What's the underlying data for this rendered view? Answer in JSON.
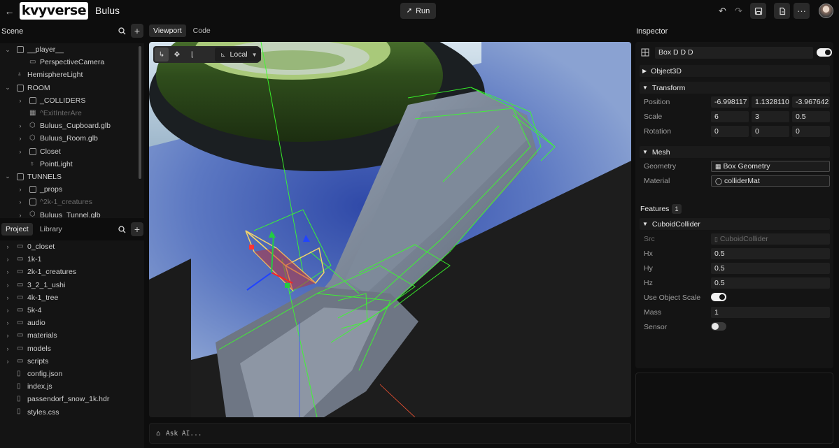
{
  "header": {
    "logo_text": "kvyverse",
    "project_title": "Bulus",
    "run_label": "Run"
  },
  "scene": {
    "title": "Scene",
    "items": [
      {
        "label": "__player__",
        "icon": "object-square",
        "expanded": true,
        "depth": 0
      },
      {
        "label": "PerspectiveCamera",
        "icon": "camera-icon",
        "depth": 1
      },
      {
        "label": "HemisphereLight",
        "icon": "lightbulb-icon",
        "depth": 0
      },
      {
        "label": "ROOM",
        "icon": "object-square",
        "expanded": true,
        "depth": 0
      },
      {
        "label": "_COLLIDERS",
        "icon": "object-square",
        "depth": 1
      },
      {
        "label": "^ExitInterAre",
        "icon": "grid-icon",
        "depth": 1
      },
      {
        "label": "Buluus_Cupboard.glb",
        "icon": "cube-icon",
        "depth": 1
      },
      {
        "label": "Buluus_Room.glb",
        "icon": "cube-icon",
        "depth": 1
      },
      {
        "label": "Closet",
        "icon": "object-square",
        "depth": 1
      },
      {
        "label": "PointLight",
        "icon": "lightbulb-icon",
        "depth": 1
      },
      {
        "label": "TUNNELS",
        "icon": "object-square",
        "expanded": true,
        "depth": 0
      },
      {
        "label": "_props",
        "icon": "object-square",
        "depth": 1
      },
      {
        "label": "^2k-1_creatures",
        "icon": "object-square",
        "depth": 1
      },
      {
        "label": "Buluus_Tunnel.glb",
        "icon": "cube-icon",
        "depth": 1
      }
    ]
  },
  "project": {
    "tabs": [
      "Project",
      "Library"
    ],
    "items": [
      {
        "label": "0_closet",
        "type": "folder"
      },
      {
        "label": "1k-1",
        "type": "folder"
      },
      {
        "label": "2k-1_creatures",
        "type": "folder"
      },
      {
        "label": "3_2_1_ushi",
        "type": "folder"
      },
      {
        "label": "4k-1_tree",
        "type": "folder"
      },
      {
        "label": "5k-4",
        "type": "folder"
      },
      {
        "label": "audio",
        "type": "folder"
      },
      {
        "label": "materials",
        "type": "folder"
      },
      {
        "label": "models",
        "type": "folder"
      },
      {
        "label": "scripts",
        "type": "folder"
      },
      {
        "label": "config.json",
        "type": "file"
      },
      {
        "label": "index.js",
        "type": "file"
      },
      {
        "label": "passendorf_snow_1k.hdr",
        "type": "file"
      },
      {
        "label": "styles.css",
        "type": "file"
      }
    ]
  },
  "editor_tabs": [
    "Viewport",
    "Code"
  ],
  "viewport": {
    "space_mode": "Local",
    "ask_placeholder": "Ask AI..."
  },
  "inspector": {
    "title": "Inspector",
    "object_name": "Box D D D",
    "object_visible": true,
    "sections": {
      "object3d": "Object3D",
      "transform": "Transform",
      "mesh": "Mesh",
      "features": "Features",
      "features_count": "1",
      "collider": "CuboidCollider"
    },
    "transform": {
      "position_label": "Position",
      "position": [
        "-6.998117",
        "1.1328110:",
        "-3.967642"
      ],
      "scale_label": "Scale",
      "scale": [
        "6",
        "3",
        "0.5"
      ],
      "rotation_label": "Rotation",
      "rotation": [
        "0",
        "0",
        "0"
      ]
    },
    "mesh": {
      "geometry_label": "Geometry",
      "geometry": "Box Geometry",
      "material_label": "Material",
      "material": "colliderMat"
    },
    "collider": {
      "src_label": "Src",
      "src": "CuboidCollider",
      "hx_label": "Hx",
      "hx": "0.5",
      "hy_label": "Hy",
      "hy": "0.5",
      "hz_label": "Hz",
      "hz": "0.5",
      "use_scale_label": "Use Object Scale",
      "use_scale": true,
      "mass_label": "Mass",
      "mass": "1",
      "sensor_label": "Sensor",
      "sensor": false
    }
  }
}
